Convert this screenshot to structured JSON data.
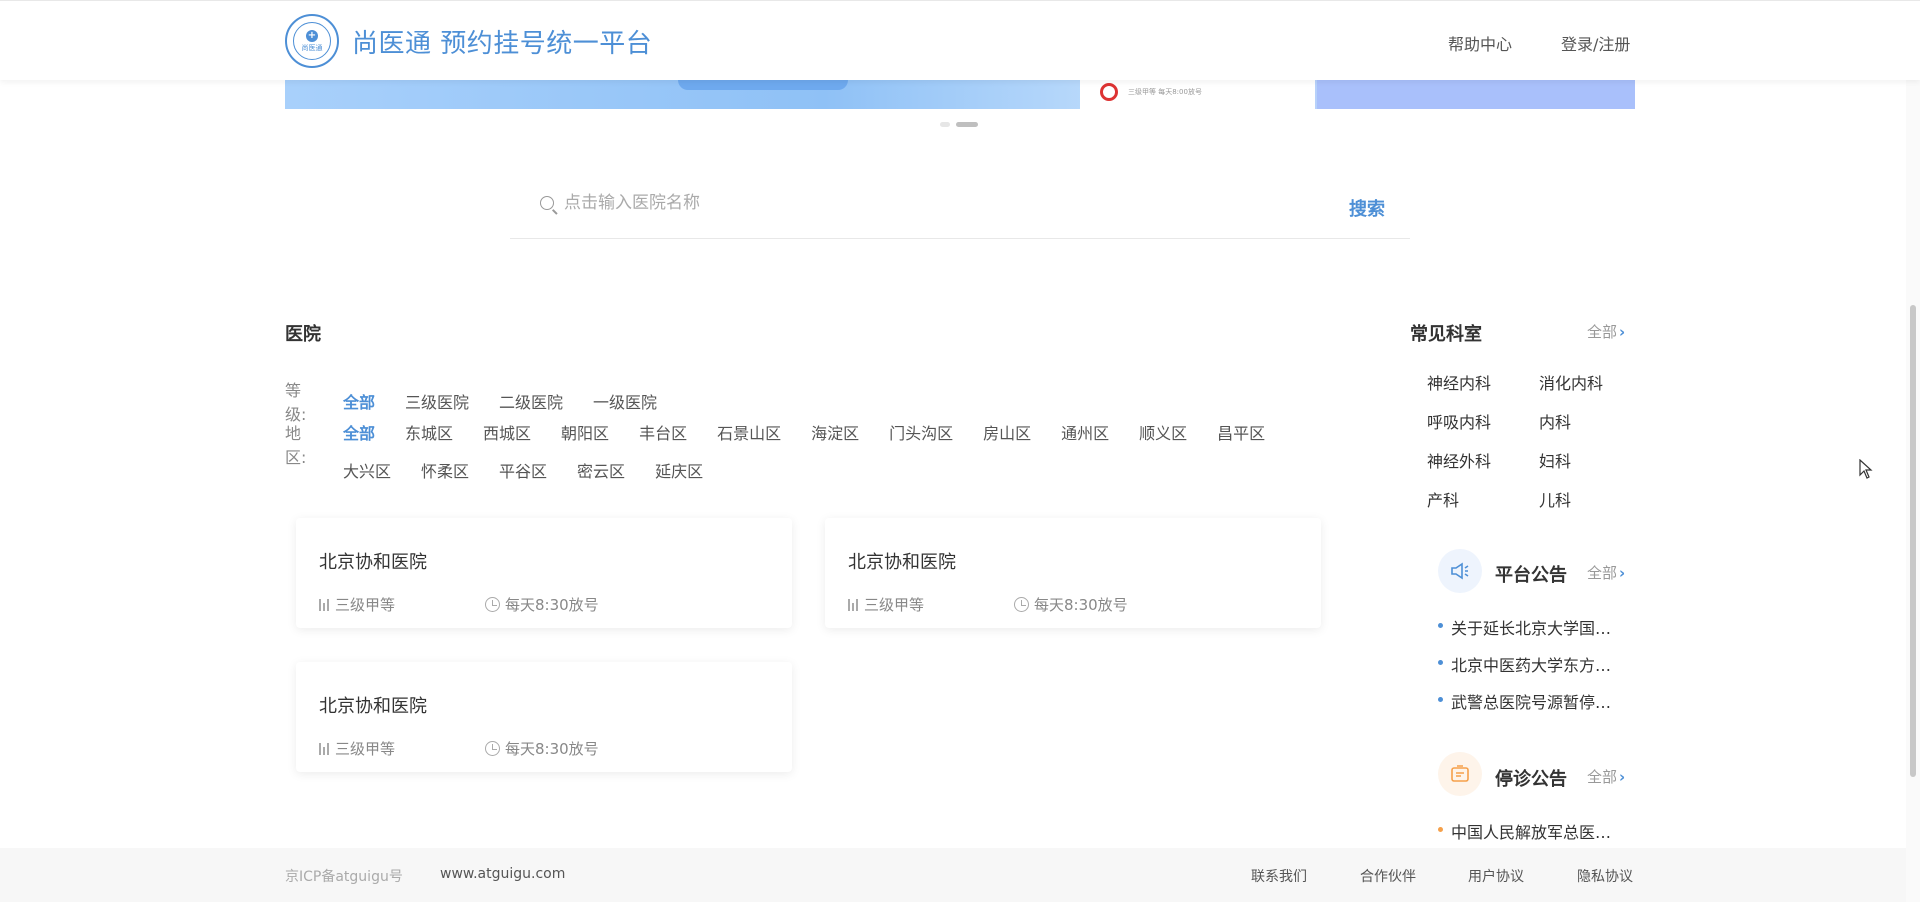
{
  "header": {
    "logo_text": "尚医通",
    "brand": "尚医通 预约挂号统一平台",
    "help": "帮助中心",
    "login": "登录/注册"
  },
  "banner": {
    "card_text": "三级甲等 每天8:00放号"
  },
  "search": {
    "placeholder": "点击输入医院名称",
    "button": "搜索"
  },
  "hospital": {
    "title": "医院",
    "level_label": "等级:",
    "levels": [
      "全部",
      "三级医院",
      "二级医院",
      "一级医院"
    ],
    "region_label": "地区:",
    "regions": [
      "全部",
      "东城区",
      "西城区",
      "朝阳区",
      "丰台区",
      "石景山区",
      "海淀区",
      "门头沟区",
      "房山区",
      "通州区",
      "顺义区",
      "昌平区",
      "大兴区",
      "怀柔区",
      "平谷区",
      "密云区",
      "延庆区"
    ],
    "cards": [
      {
        "name": "北京协和医院",
        "level": "三级甲等",
        "time": "每天8:30放号"
      },
      {
        "name": "北京协和医院",
        "level": "三级甲等",
        "time": "每天8:30放号"
      },
      {
        "name": "北京协和医院",
        "level": "三级甲等",
        "time": "每天8:30放号"
      }
    ]
  },
  "departments": {
    "title": "常见科室",
    "all": "全部",
    "items": [
      "神经内科",
      "消化内科",
      "呼吸内科",
      "内科",
      "神经外科",
      "妇科",
      "产科",
      "儿科"
    ]
  },
  "platform_notice": {
    "title": "平台公告",
    "all": "全部",
    "items": [
      "关于延长北京大学国际医院放假的通知",
      "北京中医药大学东方医院部分科室医生门诊调整",
      "武警总医院号源暂停更新通知"
    ]
  },
  "stop_notice": {
    "title": "停诊公告",
    "all": "全部",
    "items": [
      "中国人民解放军总医院第一医学中心停诊通知"
    ]
  },
  "footer": {
    "icp": "京ICP备atguigu号",
    "site": "www.atguigu.com",
    "links": [
      "联系我们",
      "合作伙伴",
      "用户协议",
      "隐私协议"
    ]
  },
  "colors": {
    "accent": "#4d8fd6",
    "orange": "#f5a04a"
  }
}
